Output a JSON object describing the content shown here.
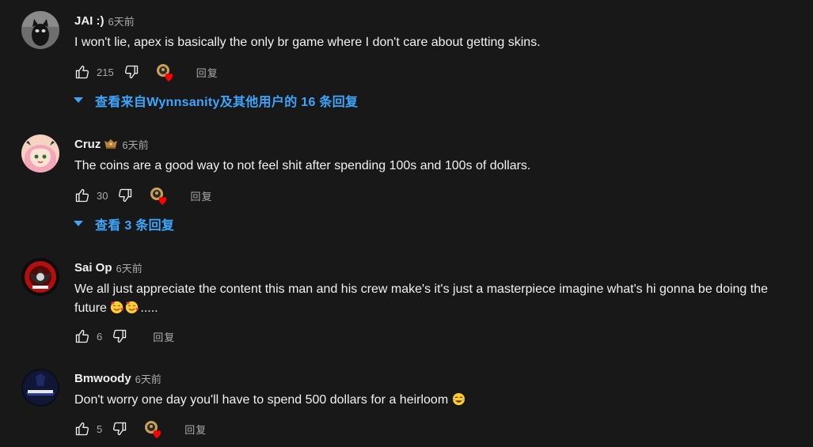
{
  "colors": {
    "background": "#181818",
    "text": "#f1f1f1",
    "secondary_text": "#aaaaaa",
    "link_blue": "#3ea6ff",
    "heart_red": "#ff0000"
  },
  "comments": [
    {
      "author": "JAI :)",
      "time": "6天前",
      "text": "I won't lie, apex is basically the only br game where I don't care about getting skins.",
      "likes": "215",
      "hearted": true,
      "reply_label": "回复",
      "view_replies": "查看来自Wynnsanity及其他用户的 16 条回复"
    },
    {
      "author": "Cruz",
      "badge_icon": "member-badge-icon",
      "time": "6天前",
      "text": "The coins are a good way to not feel shit after spending 100s and 100s of dollars.",
      "likes": "30",
      "hearted": true,
      "reply_label": "回复",
      "view_replies": "查看 3 条回复"
    },
    {
      "author": "Sai Op",
      "time": "6天前",
      "text_before_emoji": "We all just appreciate the content this man and his crew make's it's just a masterpiece imagine what's hi gonna be doing the future",
      "emojis": [
        "smiling-face-with-hearts-emoji",
        "smiling-face-with-hearts-emoji"
      ],
      "text_after_emoji": ".....",
      "likes": "6",
      "hearted": false,
      "reply_label": "回复"
    },
    {
      "author": "Bmwoody",
      "time": "6天前",
      "text_before_emoji": "Don't worry one day you'll have to spend 500 dollars for a heirloom",
      "emojis": [
        "tears-of-joy-emoji"
      ],
      "likes": "5",
      "hearted": true,
      "reply_label": "回复"
    }
  ]
}
